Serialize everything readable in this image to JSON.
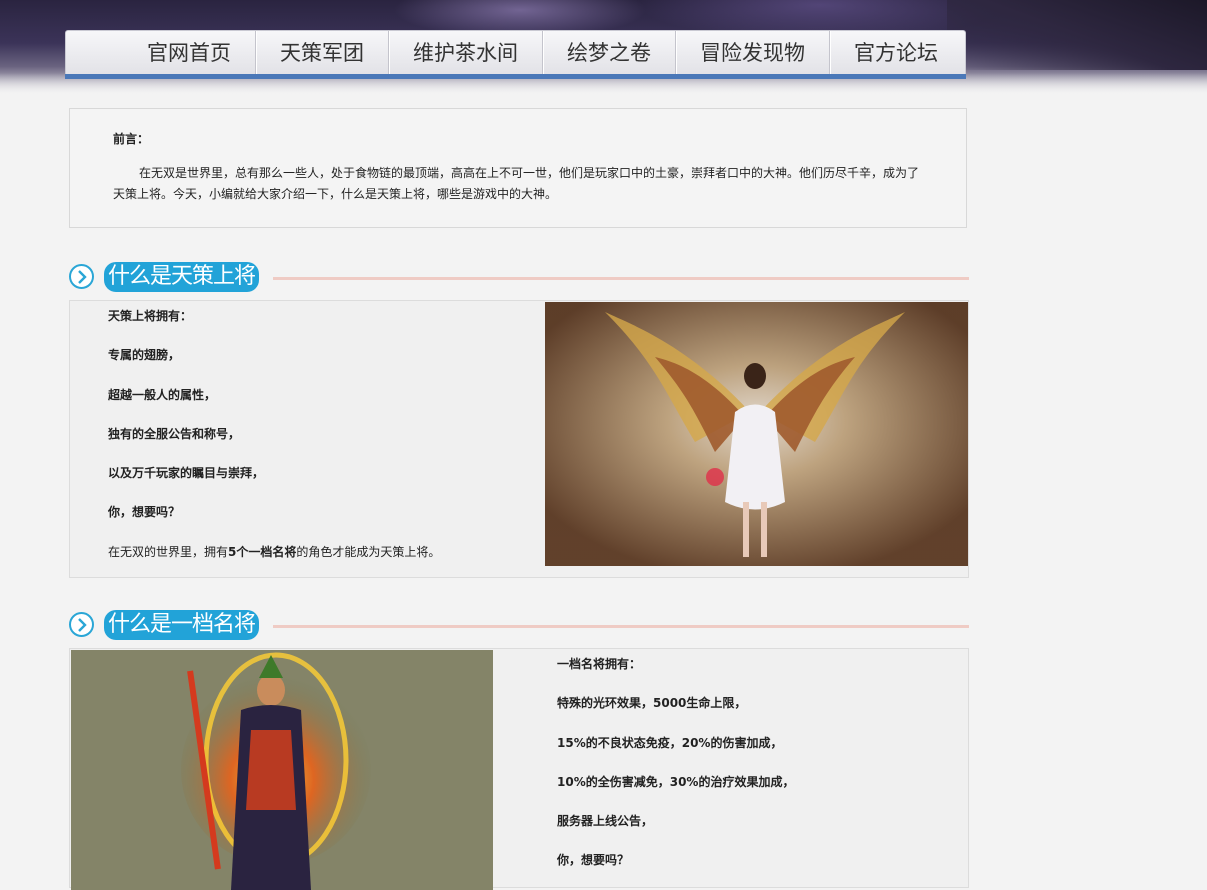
{
  "nav": {
    "items": [
      "官网首页",
      "天策军团",
      "维护茶水间",
      "绘梦之卷",
      "冒险发现物",
      "官方论坛"
    ]
  },
  "intro": {
    "heading": "前言：",
    "body": "在无双是世界里，总有那么一些人，处于食物链的最顶端，高高在上不可一世，他们是玩家口中的土豪，崇拜者口中的大神。他们历尽千辛，成为了天策上将。今天，小编就给大家介绍一下，什么是天策上将，哪些是游戏中的大神。"
  },
  "section1": {
    "title": "什么是天策上将",
    "lines": [
      "天策上将拥有：",
      "专属的翅膀，",
      "超越一般人的属性，",
      "独有的全服公告和称号，",
      "以及万千玩家的瞩目与崇拜，",
      "你，想要吗？"
    ],
    "last_line_a": "在无双的世界里，拥有",
    "last_line_b": "5个一档名将",
    "last_line_c": "的角色才能成为天策上将。"
  },
  "section2": {
    "title": "什么是一档名将",
    "lines": [
      "一档名将拥有：",
      "特殊的光环效果，5000生命上限，",
      "15%的不良状态免疫，20%的伤害加成，",
      "10%的全伤害减免，30%的治疗效果加成，",
      "服务器上线公告，",
      "你，想要吗？"
    ]
  },
  "colors": {
    "accent": "#22a3d8",
    "nav_bar": "#4a78b8",
    "divider": "#efcbc4"
  }
}
